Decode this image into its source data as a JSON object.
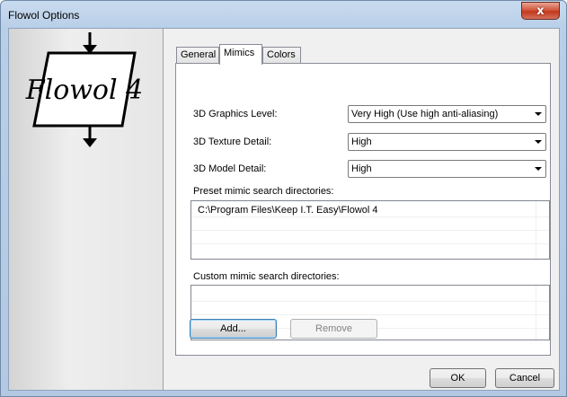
{
  "window": {
    "title": "Flowol Options",
    "close_glyph": "x"
  },
  "logo": {
    "text": "Flowol 4"
  },
  "tabs": [
    {
      "label": "General",
      "active": false
    },
    {
      "label": "Mimics",
      "active": true
    },
    {
      "label": "Colors",
      "active": false
    }
  ],
  "mimics": {
    "graphics_label": "3D Graphics Level:",
    "graphics_value": "Very High (Use high anti-aliasing)",
    "texture_label": "3D Texture Detail:",
    "texture_value": "High",
    "model_label": "3D Model Detail:",
    "model_value": "High",
    "preset_label": "Preset mimic search directories:",
    "preset_items": [
      "C:\\Program Files\\Keep I.T. Easy\\Flowol 4"
    ],
    "custom_label": "Custom mimic search directories:",
    "custom_items": [],
    "add_label": "Add...",
    "remove_label": "Remove"
  },
  "footer": {
    "ok_label": "OK",
    "cancel_label": "Cancel"
  },
  "icons": {
    "close": "close-icon",
    "dropdown": "chevron-down-icon",
    "flow_arrow": "arrow-down-icon"
  }
}
